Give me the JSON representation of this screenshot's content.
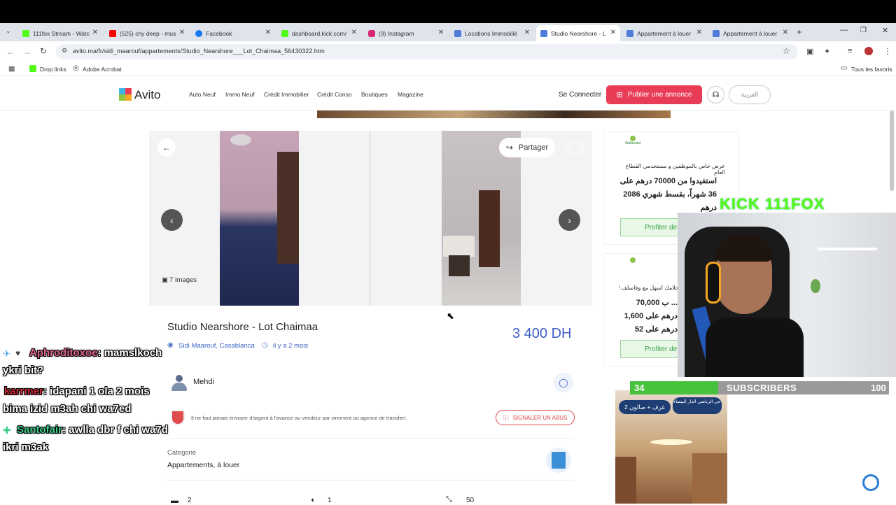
{
  "browser": {
    "tabs": [
      {
        "label": "111fox Stream - Watc",
        "color": "#53fc18"
      },
      {
        "label": "(525) chy deep - mus",
        "color": "#ff0000"
      },
      {
        "label": "Facebook",
        "color": "#1877f2"
      },
      {
        "label": "dashboard.kick.com/",
        "color": "#53fc18"
      },
      {
        "label": "(9) Instagram",
        "color": "#d62976"
      },
      {
        "label": "Locations Immobiliè",
        "color": "#4f7bd9"
      },
      {
        "label": "Studio Nearshore - L",
        "color": "#4f7bd9"
      },
      {
        "label": "Appartement à louer",
        "color": "#4f7bd9"
      },
      {
        "label": "Appartement à louer",
        "color": "#4f7bd9"
      }
    ],
    "url": "avito.ma/fr/sidi_maarouf/appartements/Studio_Nearshore___Lot_Chaimaa_56430322.htm",
    "bookmarks": [
      "Drop links",
      "Adobe Acrobat"
    ],
    "all_bookmarks": "Tous les favoris"
  },
  "site": {
    "logo": "Avito",
    "nav": [
      "Auto Neuf",
      "Immo Neuf",
      "Crédit Immobilier",
      "Crédit Conso",
      "Boutiques",
      "Magazine"
    ],
    "login": "Se Connecter",
    "publish": "Publier une annonce",
    "arabic": "العربية"
  },
  "listing": {
    "share": "Partager",
    "images_count": "7 Images",
    "title": "Studio Nearshore - Lot Chaimaa",
    "location": "Sidi Maarouf, Casablanca",
    "time": "il y a 2 mois",
    "price": "3 400 DH",
    "seller": "Mehdi",
    "warning": "Il ne faut jamais envoyer d'argent à l'avance au vendeur par virement ou agence de transfert.",
    "report": "SIGNALER UN ABUS",
    "category_label": "Categorie",
    "category_value": "Appartements, à louer",
    "stats": [
      "2",
      "1",
      "50"
    ]
  },
  "ads": {
    "ad1_brand": "Wafasalaf",
    "ad1_line1": "عرض خاص بالموظفين و مستخدمي القطاع العام",
    "ad1_main": "استفيدوا من 70000 درهم على 36 شهراً، بقسط شهري 2086 درهم",
    "ad1_btn": "Profiter de",
    "ad2_line1": "حلامك أسهل مع وفاسلف !",
    "ad2_main": "... ب 70,000 درهم على 1,600 درهم على 52 شهر",
    "ad2_btn": "Profiter de",
    "ad3_badge1": "2 غرف + صالون",
    "ad3_badge2": "حي الرياضي الدار البيضاء"
  },
  "stream": {
    "kick_label": "KICK 111FOX",
    "subs_current": "34",
    "subs_label": "SUBSCRIBERS",
    "subs_goal": "100",
    "subs_progress": 0.34,
    "chat": [
      {
        "user": "Aphroditoxoe",
        "user_color": "#e0678b",
        "text": ": mamslkoch",
        "cont": "ykri bit?"
      },
      {
        "user": "karrmer",
        "user_color": "#d0283c",
        "text": ": idapani 1 ola 2 mois",
        "cont": "bima izid m3ah chi wa7ed"
      },
      {
        "user": "Santofair",
        "user_color": "#3fce8a",
        "text": ": awlla dbr f chi wa7d",
        "cont": "ikri m3ak"
      }
    ]
  }
}
